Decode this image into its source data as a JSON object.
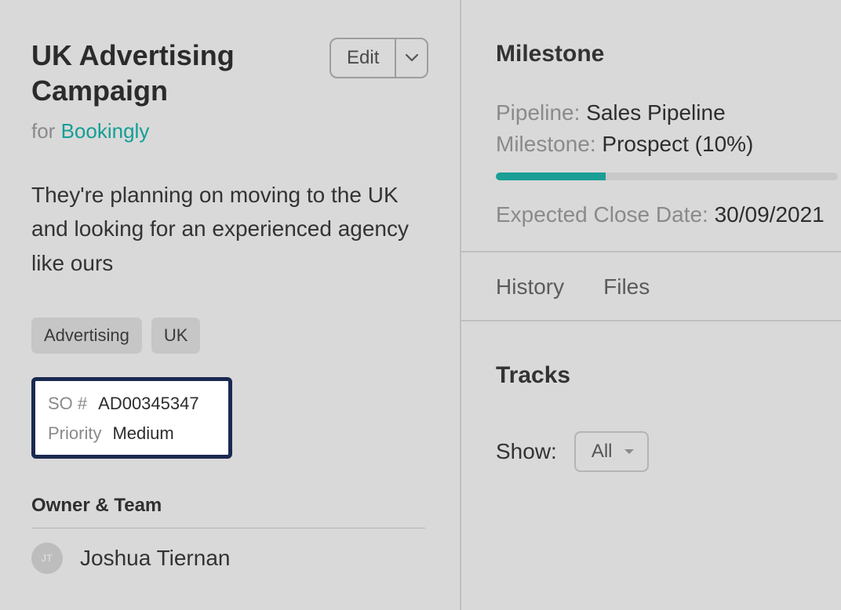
{
  "campaign": {
    "title": "UK Advertising Campaign",
    "for_prefix": "for ",
    "for_target": "Bookingly",
    "description": "They're planning on moving to the UK and looking for an experienced agency like ours",
    "tags": [
      "Advertising",
      "UK"
    ]
  },
  "edit": {
    "label": "Edit"
  },
  "so_box": {
    "so_label": "SO #",
    "so_value": "AD00345347",
    "priority_label": "Priority",
    "priority_value": "Medium"
  },
  "owner": {
    "heading": "Owner & Team",
    "initials": "JT",
    "name": "Joshua Tiernan"
  },
  "milestone": {
    "heading": "Milestone",
    "pipeline_label": "Pipeline: ",
    "pipeline_value": "Sales Pipeline",
    "milestone_label": "Milestone: ",
    "milestone_value": "Prospect (10%)",
    "progress_percent": 32,
    "expected_label": "Expected Close Date: ",
    "expected_value": "30/09/2021"
  },
  "tabs": {
    "history": "History",
    "files": "Files"
  },
  "tracks": {
    "heading": "Tracks",
    "show_label": "Show:",
    "show_value": "All"
  },
  "colors": {
    "accent": "#1a9e96",
    "highlight_border": "#1a2950"
  }
}
